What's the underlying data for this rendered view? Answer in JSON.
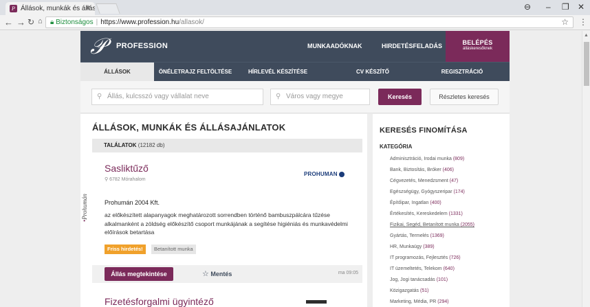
{
  "browser": {
    "tab_title": "Állások, munkák és állása",
    "secure_label": "Biztonságos",
    "url_domain": "https://www.profession.hu",
    "url_path": "/allasok/"
  },
  "header": {
    "brand": "PROFESSION",
    "links": [
      "MUNKAADÓKNAK",
      "HIRDETÉSFELADÁS"
    ],
    "login_label": "BELÉPÉS",
    "login_sub": "álláskeresőknek"
  },
  "subnav": [
    "ÁLLÁSOK",
    "ÖNÉLETRAJZ FELTÖLTÉSE",
    "HÍRLEVÉL KÉSZÍTÉSE",
    "CV KÉSZÍTŐ",
    "REGISZTRÁCIÓ"
  ],
  "search": {
    "keyword_placeholder": "Állás, kulcsszó vagy vállalat neve",
    "location_placeholder": "Város vagy megye",
    "search_button": "Keresés",
    "advanced_button": "Részletes keresés"
  },
  "main": {
    "title": "ÁLLÁSOK, MUNKÁK ÉS ÁLLÁSAJÁNLATOK",
    "results_label": "TALÁLATOK",
    "results_count": "(12182 db)",
    "job": {
      "title": "Sasliktűző",
      "location": "6782 Mórahalom",
      "company_logo": "PROHUMAN",
      "side_logo": "Prohumán",
      "company": "Prohumán 2004 Kft.",
      "description": "az előkészített alapanyagok meghatározott sorrendben történő bambuszpálcára tűzése alkalmanként a zöldség előkészítő csoport munkájának a segítése higiéniás és munkavédelmi előírások betartása",
      "tag_hot": "Friss hirdetés!",
      "tag_category": "Betanított munka",
      "view_button": "Állás megtekintése",
      "save_label": "Mentés",
      "time": "ma 09:05"
    },
    "job2_title": "Fizetésforgalmi ügyintéző"
  },
  "aside": {
    "title": "KERESÉS FINOMÍTÁSA",
    "category_label": "KATEGÓRIA",
    "categories": [
      {
        "name": "Adminisztráció, Irodai munka",
        "count": "(809)"
      },
      {
        "name": "Bank, Biztosítás, Bróker",
        "count": "(406)"
      },
      {
        "name": "Cégvezetés, Menedzsment",
        "count": "(47)"
      },
      {
        "name": "Egészségügy, Gyógyszeripar",
        "count": "(174)"
      },
      {
        "name": "Építőipar, Ingatlan",
        "count": "(400)"
      },
      {
        "name": "Értékesítés, Kereskedelem",
        "count": "(1331)"
      },
      {
        "name": "Fizikai, Segéd, Betanított munka",
        "count": "(2055)"
      },
      {
        "name": "Gyártás, Termelés",
        "count": "(1369)"
      },
      {
        "name": "HR, Munkaügy",
        "count": "(389)"
      },
      {
        "name": "IT programozás, Fejlesztés",
        "count": "(726)"
      },
      {
        "name": "IT üzemeltetés, Telekom",
        "count": "(640)"
      },
      {
        "name": "Jog, Jogi tanácsadás",
        "count": "(101)"
      },
      {
        "name": "Közigazgatás",
        "count": "(51)"
      },
      {
        "name": "Marketing, Média, PR",
        "count": "(294)"
      }
    ]
  }
}
